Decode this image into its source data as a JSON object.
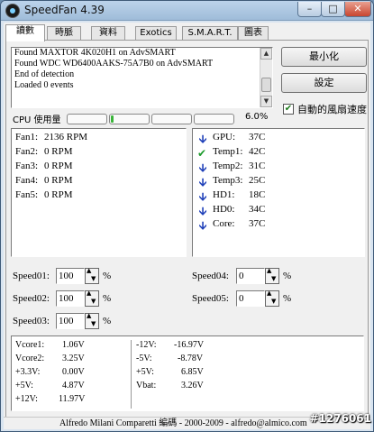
{
  "window": {
    "title": "SpeedFan 4.39"
  },
  "tabs": [
    {
      "label": "讀數"
    },
    {
      "label": "時脈"
    },
    {
      "label": "資料"
    },
    {
      "label": "Exotics"
    },
    {
      "label": "S.M.A.R.T."
    },
    {
      "label": "圖表"
    }
  ],
  "log": {
    "lines": [
      "Found MAXTOR 4K020H1 on AdvSMART",
      "Found WDC WD6400AAKS-75A7B0 on AdvSMART",
      "End of detection",
      "Loaded 0 events"
    ]
  },
  "buttons": {
    "minimize": "最小化",
    "settings": "設定"
  },
  "auto_fan": {
    "label": "自動的風扇速度",
    "checked": true
  },
  "cpu": {
    "label": "CPU 使用量",
    "percent_text": "6.0%",
    "core_loads": [
      0,
      0.05,
      0,
      0
    ]
  },
  "fans": [
    {
      "name": "Fan1:",
      "value": "2136 RPM"
    },
    {
      "name": "Fan2:",
      "value": "0 RPM"
    },
    {
      "name": "Fan3:",
      "value": "0 RPM"
    },
    {
      "name": "Fan4:",
      "value": "0 RPM"
    },
    {
      "name": "Fan5:",
      "value": "0 RPM"
    }
  ],
  "temps": [
    {
      "name": "GPU:",
      "value": "37C",
      "icon": "arrow-down-icon"
    },
    {
      "name": "Temp1:",
      "value": "42C",
      "icon": "checkmark-icon"
    },
    {
      "name": "Temp2:",
      "value": "31C",
      "icon": "arrow-down-icon"
    },
    {
      "name": "Temp3:",
      "value": "25C",
      "icon": "arrow-down-icon"
    },
    {
      "name": "HD1:",
      "value": "18C",
      "icon": "arrow-down-icon"
    },
    {
      "name": "HD0:",
      "value": "34C",
      "icon": "arrow-down-icon"
    },
    {
      "name": "Core:",
      "value": "37C",
      "icon": "arrow-down-icon"
    }
  ],
  "speeds": [
    {
      "label": "Speed01:",
      "value": "100",
      "unit": "%"
    },
    {
      "label": "Speed02:",
      "value": "100",
      "unit": "%"
    },
    {
      "label": "Speed03:",
      "value": "100",
      "unit": "%"
    },
    {
      "label": "Speed04:",
      "value": "0",
      "unit": "%"
    },
    {
      "label": "Speed05:",
      "value": "0",
      "unit": "%"
    }
  ],
  "voltages_left": [
    {
      "name": "Vcore1:",
      "value": "1.06V"
    },
    {
      "name": "Vcore2:",
      "value": "3.25V"
    },
    {
      "name": "+3.3V:",
      "value": "0.00V"
    },
    {
      "name": "+5V:",
      "value": "4.87V"
    },
    {
      "name": "+12V:",
      "value": "11.97V"
    }
  ],
  "voltages_right": [
    {
      "name": "-12V:",
      "value": "-16.97V"
    },
    {
      "name": "-5V:",
      "value": "-8.78V"
    },
    {
      "name": "+5V:",
      "value": "6.85V"
    },
    {
      "name": "Vbat:",
      "value": "3.26V"
    }
  ],
  "status_bar": {
    "text": "Alfredo Milani Comparetti 編碼 - 2000-2009 - alfredo@almico.com"
  },
  "watermark": {
    "text": "#1276061"
  }
}
